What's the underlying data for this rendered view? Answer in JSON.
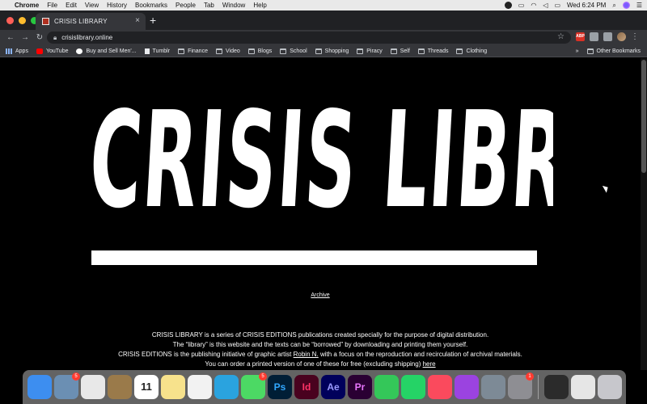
{
  "menubar": {
    "app": "Chrome",
    "items": [
      "File",
      "Edit",
      "View",
      "History",
      "Bookmarks",
      "People",
      "Tab",
      "Window",
      "Help"
    ],
    "clock": "Wed 6:24 PM"
  },
  "tab": {
    "title": "CRISIS LIBRARY"
  },
  "address": {
    "url": "crisislibrary.online"
  },
  "bookmarks": {
    "items": [
      {
        "label": "Apps",
        "icon": "grid-icon"
      },
      {
        "label": "YouTube",
        "icon": "youtube-icon"
      },
      {
        "label": "Buy and Sell Men'...",
        "icon": "google-icon"
      },
      {
        "label": "Tumblr",
        "icon": "tumblr-icon"
      },
      {
        "label": "Finance",
        "icon": "folder-icon"
      },
      {
        "label": "Video",
        "icon": "folder-icon"
      },
      {
        "label": "Blogs",
        "icon": "folder-icon"
      },
      {
        "label": "School",
        "icon": "folder-icon"
      },
      {
        "label": "Shopping",
        "icon": "folder-icon"
      },
      {
        "label": "Piracy",
        "icon": "folder-icon"
      },
      {
        "label": "Self",
        "icon": "folder-icon"
      },
      {
        "label": "Threads",
        "icon": "folder-icon"
      },
      {
        "label": "Clothing",
        "icon": "folder-icon"
      }
    ],
    "overflow": "»",
    "other": "Other Bookmarks"
  },
  "page": {
    "logo": "CRISIS LIBRARY",
    "archive_link": "Archive",
    "desc_line1": "CRISIS LIBRARY is a series of CRISIS EDITIONS publications created specially for the purpose of digital distribution.",
    "desc_line2": "The “library” is this website and the texts can be “borrowed” by downloading and printing them yourself.",
    "desc_line3_pre": "CRISIS EDITIONS is the publishing initiative of graphic artist ",
    "desc_line3_link": "Robin N.",
    "desc_line3_post": " with a focus on the reproduction and recirculation of archival materials.",
    "desc_line4_pre": "You can order a printed version of one of these for free (excluding shipping) ",
    "desc_line4_link": "here"
  },
  "dock": {
    "items": [
      {
        "name": "finder",
        "color": "#3d8ef0",
        "label": ""
      },
      {
        "name": "preview",
        "color": "#6b8fb3",
        "label": "",
        "badge": "5"
      },
      {
        "name": "chrome",
        "color": "#e8e8e8",
        "label": ""
      },
      {
        "name": "notebook",
        "color": "#9a7a4a",
        "label": ""
      },
      {
        "name": "calendar",
        "color": "#ffffff",
        "label": "11"
      },
      {
        "name": "notes",
        "color": "#f7e28c",
        "label": ""
      },
      {
        "name": "photos",
        "color": "#f2f2f2",
        "label": ""
      },
      {
        "name": "telegram",
        "color": "#2aa3df",
        "label": ""
      },
      {
        "name": "messages",
        "color": "#4cd964",
        "label": "",
        "badge": "5"
      },
      {
        "name": "photoshop",
        "color": "#001e36",
        "label": "Ps"
      },
      {
        "name": "indesign",
        "color": "#49021f",
        "label": "Id"
      },
      {
        "name": "after-effects",
        "color": "#00005b",
        "label": "Ae"
      },
      {
        "name": "premiere",
        "color": "#2a0033",
        "label": "Pr"
      },
      {
        "name": "facetime",
        "color": "#34c759",
        "label": ""
      },
      {
        "name": "whatsapp",
        "color": "#25d366",
        "label": ""
      },
      {
        "name": "music",
        "color": "#fa4a5d",
        "label": ""
      },
      {
        "name": "podcasts",
        "color": "#9b43e0",
        "label": ""
      },
      {
        "name": "image-capture",
        "color": "#7d8a96",
        "label": ""
      },
      {
        "name": "system-preferences",
        "color": "#8e8e93",
        "label": "",
        "badge": "1"
      },
      {
        "name": "folder-dark",
        "color": "#2b2b2b",
        "label": ""
      },
      {
        "name": "document",
        "color": "#e6e6e6",
        "label": ""
      },
      {
        "name": "trash",
        "color": "#c7c7cc",
        "label": ""
      }
    ]
  }
}
